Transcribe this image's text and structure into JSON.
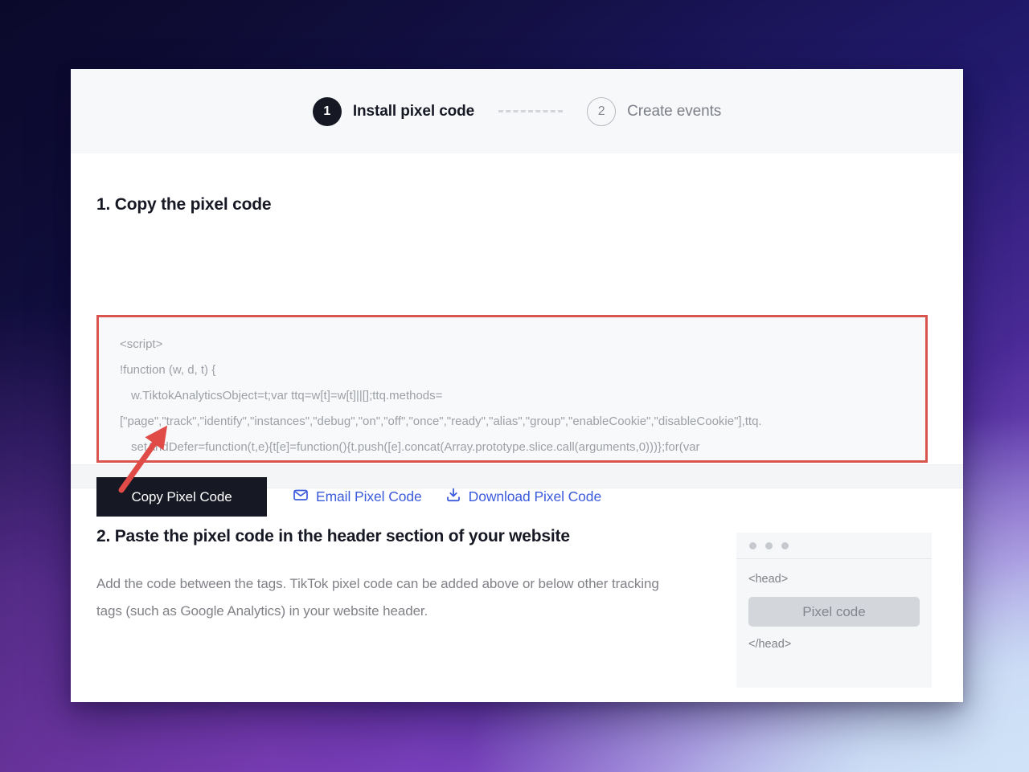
{
  "theme": {
    "accent_dark": "#161823",
    "link_blue": "#3b5bdb",
    "annotation_red": "#d9534f",
    "code_text": "#9da0a6"
  },
  "stepper": {
    "steps": [
      {
        "number": "1",
        "label": "Install pixel code",
        "state": "active"
      },
      {
        "number": "2",
        "label": "Create events",
        "state": "inactive"
      }
    ]
  },
  "section_one": {
    "heading": "1. Copy the pixel code",
    "code_lines": [
      "<script>",
      "!function (w, d, t) {",
      "  w.TiktokAnalyticsObject=t;var ttq=w[t]=w[t]||[];ttq.methods=",
      "[\"page\",\"track\",\"identify\",\"instances\",\"debug\",\"on\",\"off\",\"once\",\"ready\",\"alias\",\"group\",\"enableCookie\",\"disableCookie\"],ttq.",
      "setAndDefer=function(t,e){t[e]=function(){t.push([e].concat(Array.prototype.slice.call(arguments,0)))};for(var"
    ],
    "actions": {
      "copy_label": "Copy Pixel Code",
      "email_label": "Email Pixel Code",
      "email_icon": "envelope-icon",
      "download_label": "Download Pixel Code",
      "download_icon": "download-icon"
    }
  },
  "section_two": {
    "heading": "2. Paste the pixel code in the header section of your website",
    "body": "Add the code between the tags. TikTok pixel code can be added above or below other tracking tags (such as Google Analytics) in your website header.",
    "browser_mock": {
      "open_tag": "<head>",
      "placeholder_label": "Pixel code",
      "close_tag": "</head>"
    }
  },
  "annotation": {
    "arrow_name": "arrow-pointing-to-copy-button"
  }
}
